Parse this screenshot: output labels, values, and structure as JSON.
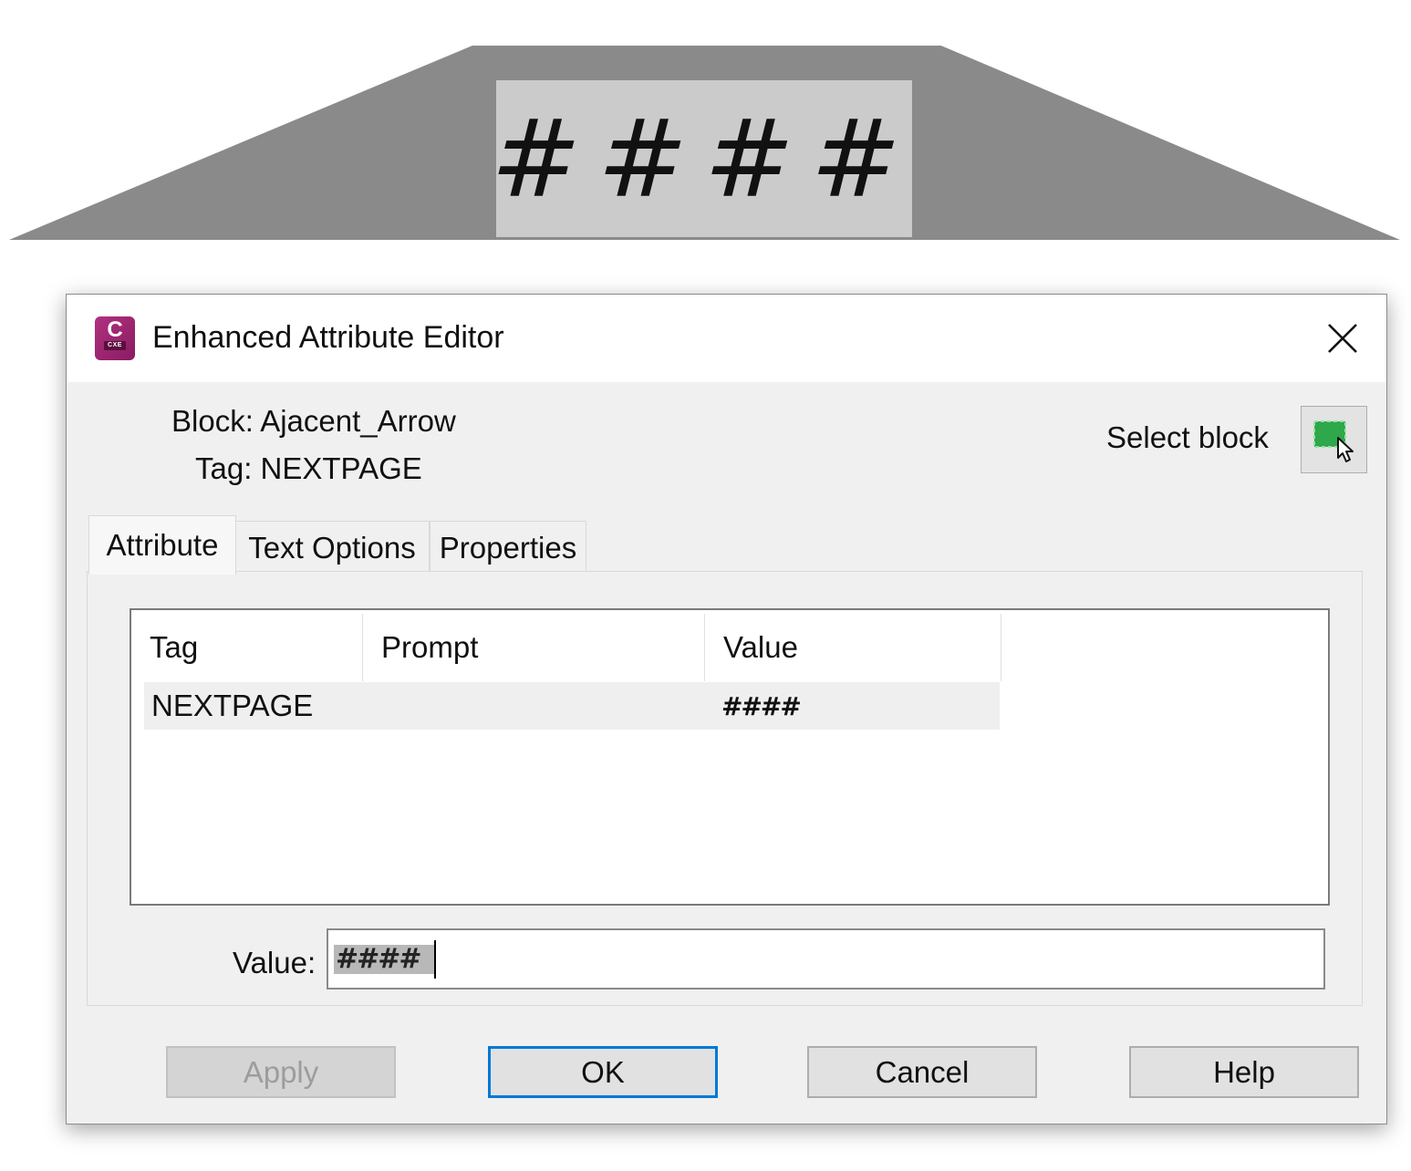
{
  "drawing": {
    "attribute_display": "####"
  },
  "dialog": {
    "title": "Enhanced Attribute Editor",
    "app_icon_letter": "C",
    "app_icon_sub": "CXE",
    "block_label": "Block: Ajacent_Arrow",
    "tag_label": "Tag: NEXTPAGE",
    "select_block_label": "Select block",
    "tabs": [
      {
        "label": "Attribute",
        "active": true
      },
      {
        "label": "Text Options",
        "active": false
      },
      {
        "label": "Properties",
        "active": false
      }
    ],
    "table": {
      "columns": [
        "Tag",
        "Prompt",
        "Value"
      ],
      "rows": [
        {
          "tag": "NEXTPAGE",
          "prompt": "",
          "value": "####"
        }
      ]
    },
    "value_field": {
      "label": "Value:",
      "value": "####"
    },
    "buttons": {
      "apply": "Apply",
      "ok": "OK",
      "cancel": "Cancel",
      "help": "Help"
    },
    "colors": {
      "accent": "#0078d7",
      "icon": "#b0317f",
      "select_icon": "#2ea84a"
    }
  }
}
